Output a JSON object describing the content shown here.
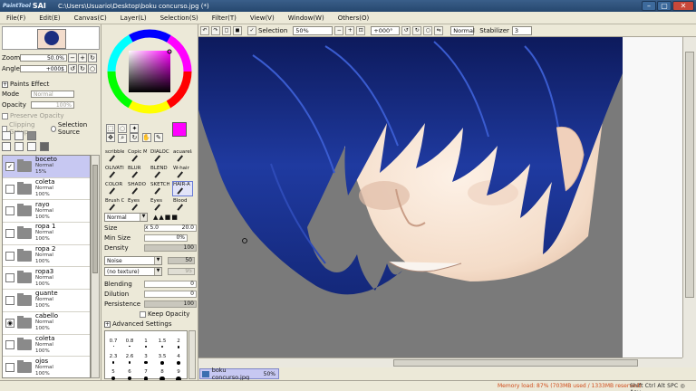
{
  "app": {
    "logo_small": "PaintTool",
    "logo_big": "SAI",
    "title": "C:\\Users\\Usuario\\Desktop\\boku concurso.jpg (*)"
  },
  "window_controls": {
    "minimize": "–",
    "maximize": "▢",
    "close": "✕"
  },
  "menu": [
    {
      "label": "File(F)"
    },
    {
      "label": "Edit(E)"
    },
    {
      "label": "Canvas(C)"
    },
    {
      "label": "Layer(L)"
    },
    {
      "label": "Selection(S)"
    },
    {
      "label": "Filter(T)"
    },
    {
      "label": "View(V)"
    },
    {
      "label": "Window(W)"
    },
    {
      "label": "Others(O)"
    }
  ],
  "navigator": {
    "zoom_label": "Zoom",
    "zoom_value": "50.0%",
    "angle_label": "Angle",
    "angle_value": "+000$"
  },
  "paints_effect": {
    "header": "Paints Effect",
    "mode_label": "Mode",
    "mode_value": "Normal",
    "opacity_label": "Opacity",
    "opacity_value": "100%",
    "preserve_opacity": "Preserve Opacity",
    "clipping_group": "Clipping Group",
    "selection_source": "Selection Source"
  },
  "layers": [
    {
      "name": "boceto",
      "mode": "Normal",
      "opacity": "15%",
      "selected": true,
      "visible": true
    },
    {
      "name": "coleta",
      "mode": "Normal",
      "opacity": "100%",
      "selected": false,
      "visible": false
    },
    {
      "name": "rayo",
      "mode": "Normal",
      "opacity": "100%",
      "selected": false,
      "visible": false
    },
    {
      "name": "ropa 1",
      "mode": "Normal",
      "opacity": "100%",
      "selected": false,
      "visible": false
    },
    {
      "name": "ropa 2",
      "mode": "Normal",
      "opacity": "100%",
      "selected": false,
      "visible": false
    },
    {
      "name": "ropa3",
      "mode": "Normal",
      "opacity": "100%",
      "selected": false,
      "visible": false
    },
    {
      "name": "guante",
      "mode": "Normal",
      "opacity": "100%",
      "selected": false,
      "visible": false
    },
    {
      "name": "cabello",
      "mode": "Normal",
      "opacity": "100%",
      "selected": false,
      "visible": true
    },
    {
      "name": "coleta",
      "mode": "Normal",
      "opacity": "100%",
      "selected": false,
      "visible": false
    },
    {
      "name": "ojos",
      "mode": "Normal",
      "opacity": "100%",
      "selected": false,
      "visible": false
    }
  ],
  "colors": {
    "primary": "#ff00ff",
    "secondary": "#e8eefb",
    "hair": "#1a2f8a",
    "skin": "#f4dcc8",
    "canvas_bg": "#7a7a7a",
    "selection": "#c7c8f2",
    "memory_text": "#d04a18"
  },
  "brushes": [
    {
      "label": "scribbles",
      "selected": false
    },
    {
      "label": "Copic M",
      "selected": false
    },
    {
      "label": "DIALOC",
      "selected": false
    },
    {
      "label": "acuarela",
      "selected": false
    },
    {
      "label": "OLIVATI",
      "selected": false
    },
    {
      "label": "BLUR",
      "selected": false
    },
    {
      "label": "BLEND",
      "selected": false
    },
    {
      "label": "W-hair",
      "selected": false
    },
    {
      "label": "COLOR",
      "selected": false
    },
    {
      "label": "SHADO",
      "selected": false
    },
    {
      "label": "SKETCH",
      "selected": false
    },
    {
      "label": "HAIR-A",
      "selected": true
    },
    {
      "label": "Brush Cl",
      "selected": false
    },
    {
      "label": "Eyes",
      "selected": false
    },
    {
      "label": "Eyes",
      "selected": false
    },
    {
      "label": "Blood",
      "selected": false
    }
  ],
  "brush_settings": {
    "mode": "Normal",
    "size_label": "Size",
    "size_mult": "x 5.0",
    "size_value": "20.0",
    "minsize_label": "Min Size",
    "minsize_value": "0%",
    "density_label": "Density",
    "density_value": "100",
    "noise_label": "Noise",
    "noise_value": "50",
    "texture_label": "(no texture)",
    "texture_value": "95",
    "blending_label": "Blending",
    "blending_value": "0",
    "dilution_label": "Dilution",
    "dilution_value": "0",
    "persistence_label": "Persistence",
    "persistence_value": "100",
    "keep_opacity": "Keep Opacity",
    "advanced": "Advanced Settings"
  },
  "size_presets": {
    "row1": [
      "0.7",
      "0.8",
      "1",
      "1.5",
      "2"
    ],
    "row2": [
      "2.3",
      "2.6",
      "3",
      "3.5",
      "4"
    ],
    "row3": [
      "5",
      "6",
      "7",
      "8",
      "9"
    ]
  },
  "canvas_toolbar": {
    "selection_label": "Selection",
    "zoom_value": "50%",
    "angle_value": "+000°",
    "blend_mode": "Normal",
    "stabilizer_label": "Stabilizer",
    "stabilizer_value": "3"
  },
  "document_tab": {
    "name": "boku concurso.jpg",
    "zoom": "50%"
  },
  "status": {
    "memory": "Memory load: 87% (703MB used / 1333MB reserved)",
    "keys": "Shift Ctrl Alt SPC ◎ Any"
  }
}
